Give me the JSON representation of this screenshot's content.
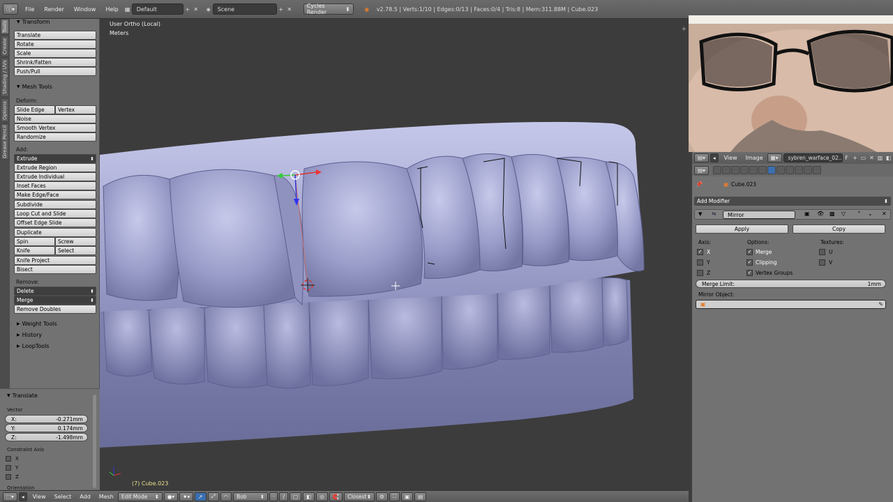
{
  "topbar": {
    "menus": [
      "File",
      "Render",
      "Window",
      "Help"
    ],
    "screen_layout": "Default",
    "scene": "Scene",
    "render_engine": "Cycles Render",
    "stats": "v2.78.5 | Verts:1/10 | Edges:0/13 | Faces:0/4 | Tris:8 | Mem:311.88M | Cube.023"
  },
  "tabs": [
    "Tools",
    "Create",
    "Shading / UVs",
    "Options",
    "Grease Pencil"
  ],
  "toolshelf": {
    "transform_title": "Transform",
    "transform": [
      "Translate",
      "Rotate",
      "Scale",
      "Shrink/Fatten",
      "Push/Pull"
    ],
    "mesh_tools_title": "Mesh Tools",
    "deform_label": "Deform:",
    "slide_edge": "Slide Edge",
    "vertex": "Vertex",
    "noise": "Noise",
    "smooth_vertex": "Smooth Vertex",
    "randomize": "Randomize",
    "add_label": "Add:",
    "extrude": "Extrude",
    "add_items": [
      "Extrude Region",
      "Extrude Individual",
      "Inset Faces",
      "Make Edge/Face",
      "Subdivide",
      "Loop Cut and Slide",
      "Offset Edge Slide",
      "Duplicate"
    ],
    "spin": "Spin",
    "screw": "Screw",
    "knife": "Knife",
    "select": "Select",
    "knife_project": "Knife Project",
    "bisect": "Bisect",
    "remove_label": "Remove:",
    "delete": "Delete",
    "merge": "Merge",
    "remove_doubles": "Remove Doubles",
    "weight_tools": "Weight Tools",
    "history": "History",
    "looptools": "LoopTools"
  },
  "operator": {
    "title": "Translate",
    "vector_label": "Vector",
    "x_label": "X:",
    "x_value": "-0.271mm",
    "y_label": "Y:",
    "y_value": "0.174mm",
    "z_label": "Z:",
    "z_value": "-1.498mm",
    "constraint_label": "Constraint Axis",
    "axes": [
      "X",
      "Y",
      "Z"
    ],
    "orientation_label": "Orientation"
  },
  "viewport": {
    "view_name": "User Ortho (Local)",
    "units": "Meters",
    "object_info": "(7) Cube.023"
  },
  "bottombar": {
    "menus": [
      "View",
      "Select",
      "Add",
      "Mesh"
    ],
    "mode": "Edit Mode",
    "pivot_label": "Bob",
    "snap_target": "Closest"
  },
  "props": {
    "header_menus": [
      "View",
      "Image"
    ],
    "image_name": "sybren_warface_02...",
    "image_suffix": "F",
    "object_path": "Cube.023",
    "add_modifier": "Add Modifier",
    "modifier_name": "Mirror",
    "apply": "Apply",
    "copy": "Copy",
    "axis_label": "Axis:",
    "options_label": "Options:",
    "textures_label": "Textures:",
    "axis_x": "X",
    "axis_y": "Y",
    "axis_z": "Z",
    "opt_merge": "Merge",
    "opt_clipping": "Clipping",
    "opt_vertex_groups": "Vertex Groups",
    "tex_u": "U",
    "tex_v": "V",
    "merge_limit_label": "Merge Limit:",
    "merge_limit_value": "1mm",
    "mirror_object_label": "Mirror Object:"
  },
  "colors": {
    "mesh": "#8c8fbf",
    "background": "#3c3c3c",
    "panel": "#727272",
    "active_tab": "#3b6fb0"
  }
}
